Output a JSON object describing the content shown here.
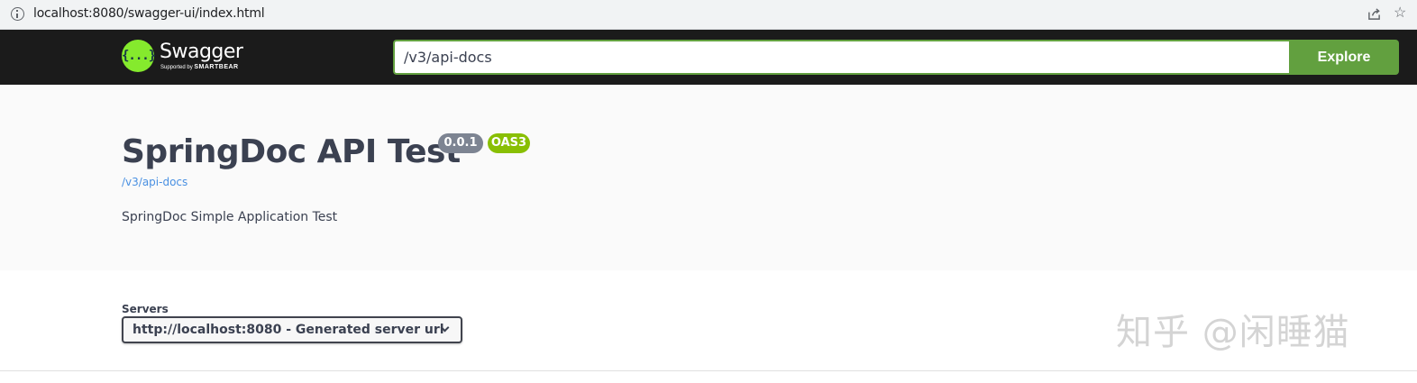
{
  "browser": {
    "url": "localhost:8080/swagger-ui/index.html"
  },
  "topbar": {
    "logo_glyph": "{...}",
    "brand": "Swagger",
    "supported_by": "Supported by",
    "smartbear": "SMARTBEAR",
    "url_value": "/v3/api-docs",
    "explore_label": "Explore"
  },
  "info": {
    "title": "SpringDoc API Test",
    "version": "0.0.1",
    "oas_badge": "OAS3",
    "doc_link": "/v3/api-docs",
    "description": "SpringDoc Simple Application Test"
  },
  "servers": {
    "label": "Servers",
    "selected": "http://localhost:8080 - Generated server url"
  },
  "watermark": "知乎 @闲睡猫",
  "colors": {
    "topbar_bg": "#1b1b1b",
    "accent_green": "#62a03f",
    "logo_green": "#85ea2d",
    "version_badge": "#7d8492",
    "oas_badge": "#89bf04",
    "link_blue": "#4990e2",
    "text_dark": "#3b4151"
  },
  "icons": {
    "address_info": "info-icon",
    "share": "share-icon",
    "bookmark": "star-icon",
    "select_arrow": "chevron-down-icon"
  }
}
